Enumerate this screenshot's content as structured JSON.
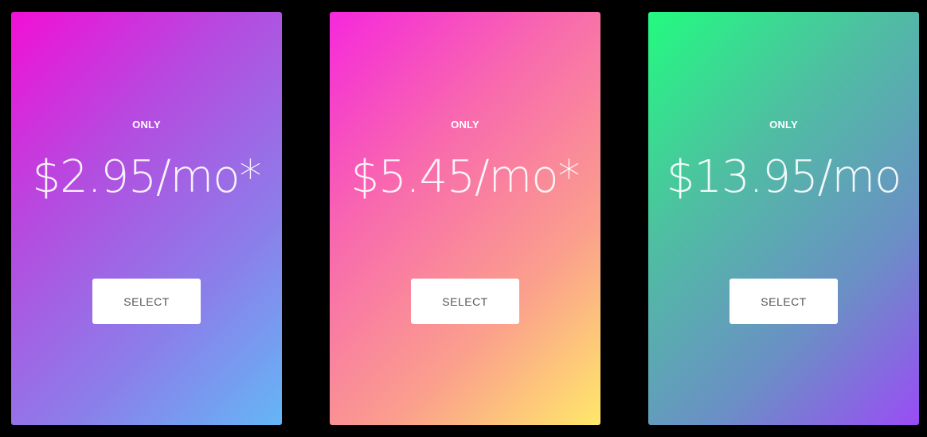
{
  "plans": [
    {
      "label": "ONLY",
      "price": "$2.95/mo*",
      "button": "SELECT"
    },
    {
      "label": "ONLY",
      "price": "$5.45/mo*",
      "button": "SELECT"
    },
    {
      "label": "ONLY",
      "price": "$13.95/mo",
      "button": "SELECT"
    }
  ],
  "colors": {
    "background": "#000000",
    "card1_start": "#f20fd6",
    "card1_end": "#64b6f6",
    "card2_start": "#f528dc",
    "card2_end": "#ffe86a",
    "card3_start": "#23fb80",
    "card3_end": "#9a4cf5",
    "button_bg": "#ffffff",
    "button_text": "#555555"
  }
}
